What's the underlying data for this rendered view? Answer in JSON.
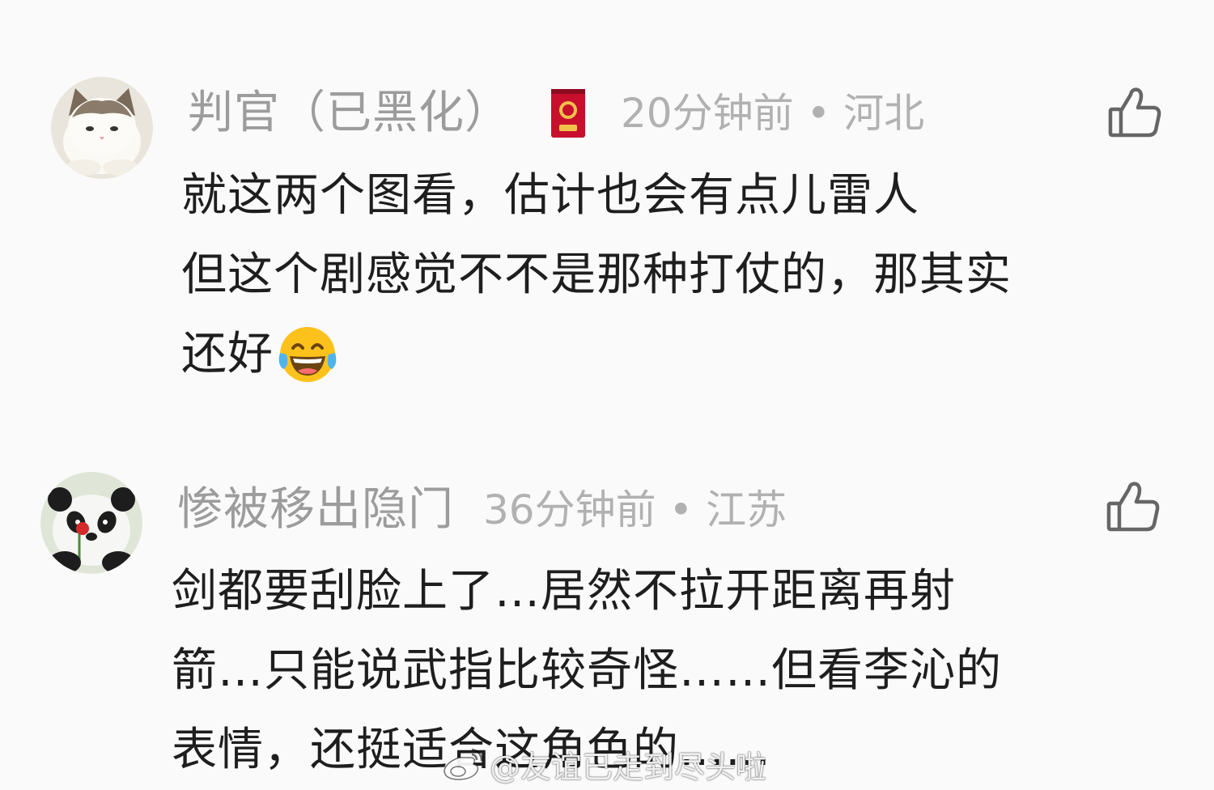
{
  "comments": [
    {
      "username": "判官（已黑化）",
      "time": "20分钟前",
      "location": "河北",
      "lines": [
        "就这两个图看，估计也会有点儿雷人",
        "但这个剧感觉不不是那种打仗的，那其实",
        "还好"
      ],
      "emoji": "laughing-tears-emoji"
    },
    {
      "username": "惨被移出隐门",
      "time": "36分钟前",
      "location": "江苏",
      "lines": [
        "剑都要刮脸上了…居然不拉开距离再射",
        "箭…只能说武指比较奇怪……但看李沁的",
        "表情，还挺适合这角色的……"
      ]
    }
  ],
  "meta_separator": "•",
  "watermark": "@友谊已走到尽头啦",
  "icons": {
    "like": "thumbs-up-icon",
    "badge": "red-envelope-badge-icon",
    "watermark_logo": "weibo-icon"
  },
  "colors": {
    "background": "#fafafa",
    "text_primary": "#1e1e1e",
    "text_secondary": "#a3a3a3",
    "badge_red": "#c8102e"
  }
}
